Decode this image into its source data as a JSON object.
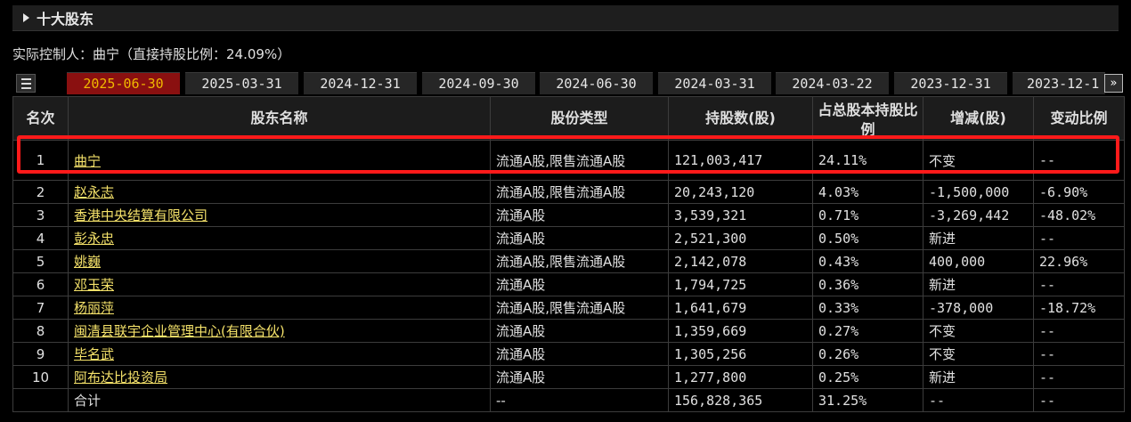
{
  "section": {
    "title": "十大股东"
  },
  "controller_text": "实际控制人：曲宁（直接持股比例：24.09%）",
  "tabs": [
    "2025-06-30",
    "2025-03-31",
    "2024-12-31",
    "2024-09-30",
    "2024-06-30",
    "2024-03-31",
    "2024-03-22",
    "2023-12-31",
    "2023-12-1"
  ],
  "active_tab": 0,
  "icons": {
    "list": "list-icon",
    "next": "double-chevron-right-icon"
  },
  "next_glyph": "»",
  "colors": {
    "active_tab_bg": "#8a1010",
    "active_tab_text": "#f0b800",
    "link": "#f5e26a",
    "up": "#ff3b3b",
    "down": "#2ede3a",
    "highlight": "#ff1a1a"
  },
  "table": {
    "headers": [
      "名次",
      "股东名称",
      "股份类型",
      "持股数(股)",
      "占总股本持股比例",
      "增减(股)",
      "变动比例"
    ],
    "rows": [
      {
        "rank": "1",
        "name": "曲宁",
        "type": "流通A股,限售流通A股",
        "shares": "121,003,417",
        "ratio": "24.11%",
        "change": "不变",
        "change_color": "white",
        "pct": "--",
        "pct_color": "white"
      },
      {
        "rank": "2",
        "name": "赵永志",
        "type": "流通A股,限售流通A股",
        "shares": "20,243,120",
        "ratio": "4.03%",
        "change": "-1,500,000",
        "change_color": "green",
        "pct": "-6.90%",
        "pct_color": "green"
      },
      {
        "rank": "3",
        "name": "香港中央结算有限公司",
        "type": "流通A股",
        "shares": "3,539,321",
        "ratio": "0.71%",
        "change": "-3,269,442",
        "change_color": "green",
        "pct": "-48.02%",
        "pct_color": "green"
      },
      {
        "rank": "4",
        "name": "彭永忠",
        "type": "流通A股",
        "shares": "2,521,300",
        "ratio": "0.50%",
        "change": "新进",
        "change_color": "red",
        "pct": "--",
        "pct_color": "red"
      },
      {
        "rank": "5",
        "name": "姚巍",
        "type": "流通A股,限售流通A股",
        "shares": "2,142,078",
        "ratio": "0.43%",
        "change": "400,000",
        "change_color": "red",
        "pct": "22.96%",
        "pct_color": "red"
      },
      {
        "rank": "6",
        "name": "邓玉荣",
        "type": "流通A股",
        "shares": "1,794,725",
        "ratio": "0.36%",
        "change": "新进",
        "change_color": "red",
        "pct": "--",
        "pct_color": "red"
      },
      {
        "rank": "7",
        "name": "杨丽萍",
        "type": "流通A股,限售流通A股",
        "shares": "1,641,679",
        "ratio": "0.33%",
        "change": "-378,000",
        "change_color": "green",
        "pct": "-18.72%",
        "pct_color": "green"
      },
      {
        "rank": "8",
        "name": "闽清县联宇企业管理中心(有限合伙)",
        "type": "流通A股",
        "shares": "1,359,669",
        "ratio": "0.27%",
        "change": "不变",
        "change_color": "white",
        "pct": "--",
        "pct_color": "white"
      },
      {
        "rank": "9",
        "name": "毕名武",
        "type": "流通A股",
        "shares": "1,305,256",
        "ratio": "0.26%",
        "change": "不变",
        "change_color": "white",
        "pct": "--",
        "pct_color": "white"
      },
      {
        "rank": "10",
        "name": "阿布达比投资局",
        "type": "流通A股",
        "shares": "1,277,800",
        "ratio": "0.25%",
        "change": "新进",
        "change_color": "red",
        "pct": "--",
        "pct_color": "red"
      }
    ],
    "total": {
      "label": "合计",
      "type": "--",
      "shares": "156,828,365",
      "ratio": "31.25%",
      "change": "--",
      "pct": "--"
    }
  }
}
